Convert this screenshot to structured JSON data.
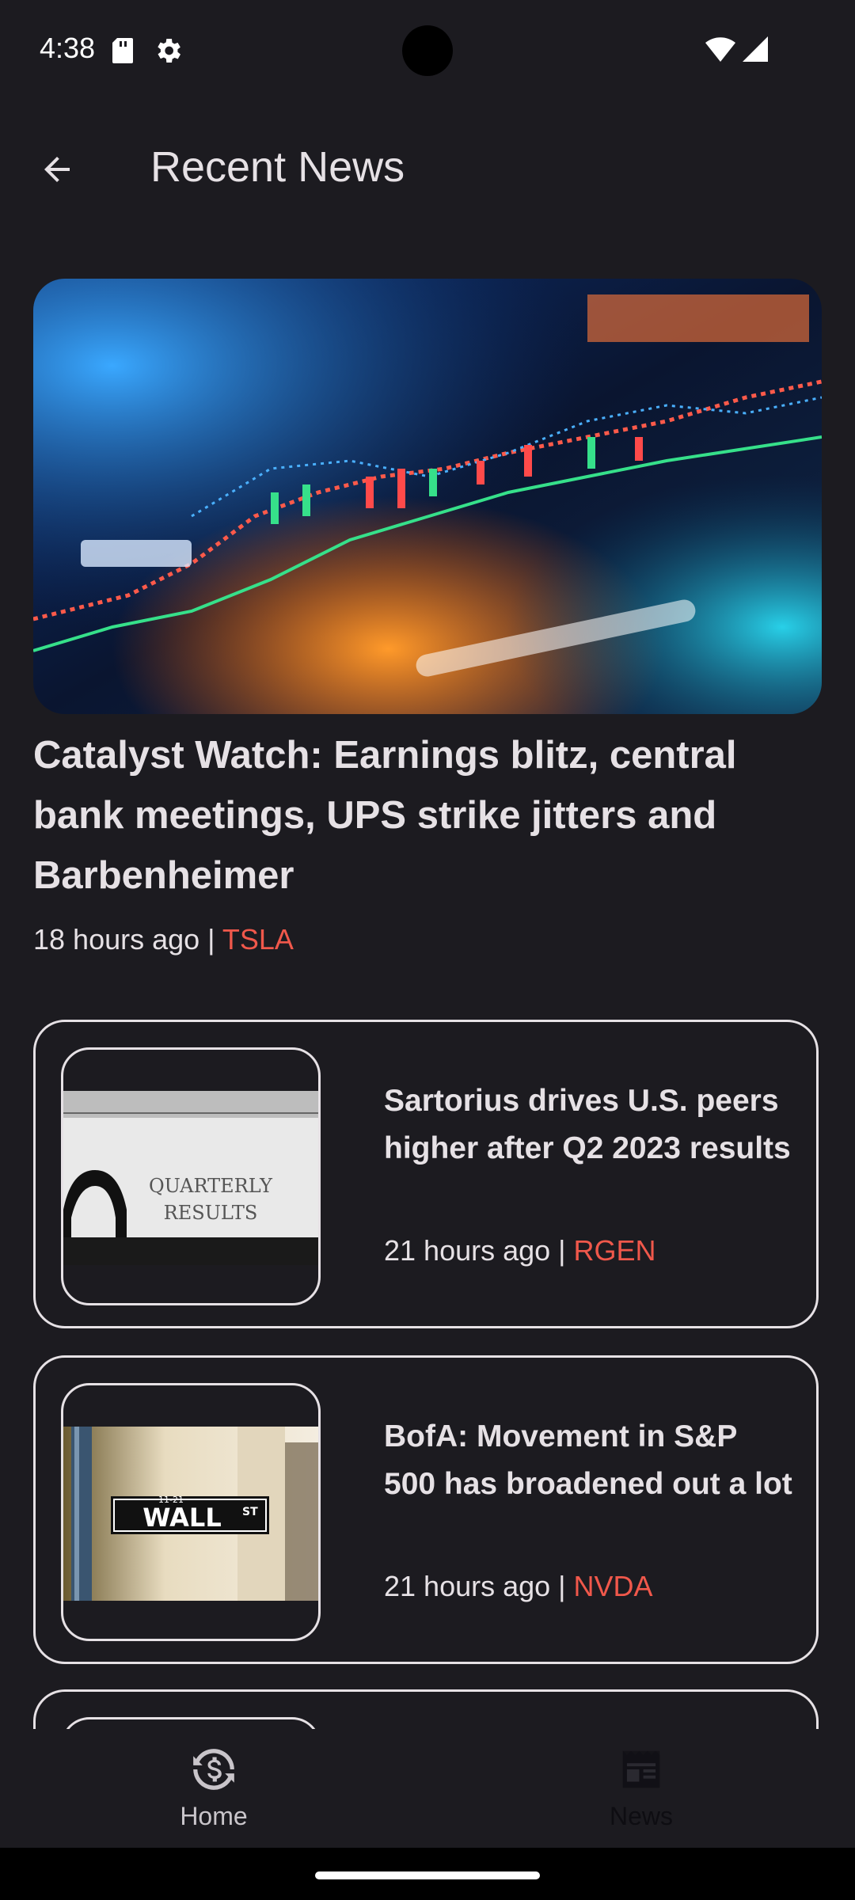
{
  "status_bar": {
    "time": "4:38"
  },
  "app_bar": {
    "title": "Recent News"
  },
  "featured": {
    "title": "Catalyst Watch: Earnings blitz, central bank meetings, UPS strike jitters and Barbenheimer",
    "time": "18 hours ago |",
    "ticker": "TSLA"
  },
  "articles": [
    {
      "title": "Sartorius drives U.S. peers higher after Q2 2023 results",
      "time": "21 hours ago |",
      "ticker": "RGEN",
      "image_text": [
        "QUARTERLY",
        "RESULTS"
      ]
    },
    {
      "title": "BofA: Movement in S&P 500 has broadened out a lot",
      "time": "21 hours ago |",
      "ticker": "NVDA",
      "image_text": [
        "WALL",
        "ST",
        "11-21"
      ]
    }
  ],
  "bottom_nav": {
    "home_label": "Home",
    "news_label": "News"
  },
  "colors": {
    "background": "#1c1b20",
    "text": "#e6e1e5",
    "ticker": "#f0584b"
  }
}
